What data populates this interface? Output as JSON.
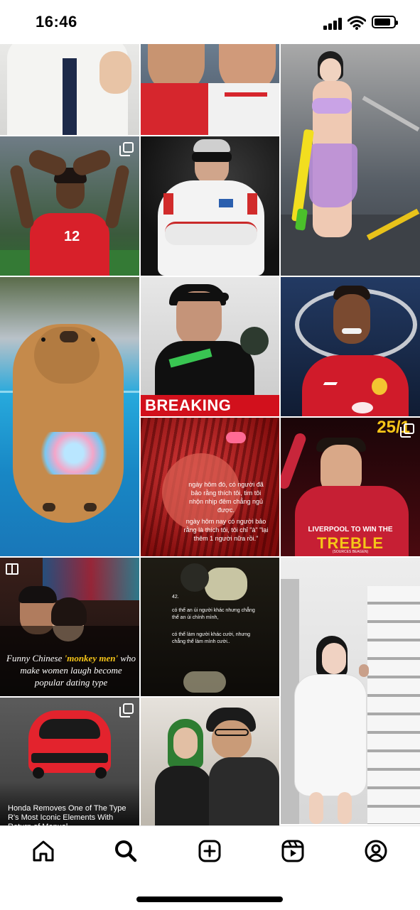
{
  "status_bar": {
    "time": "16:46"
  },
  "grid": {
    "tile6_caption": "BREAKING",
    "tile7_text_1": "ngày hôm đó, có người đã bảo rằng thích tôi, tim tôi nhộn nhịp đêm chẳng ngủ được.",
    "tile7_text_2": "ngày hôm nay có người bảo rằng là thích tôi, tôi chỉ \"à\" \"lại thêm 1 người nữa rồi.\"",
    "tile8_number": "25/1",
    "tile8_title_1": "LIVERPOOL TO WIN THE",
    "tile8_title_2": "TREBLE",
    "tile8_sub": "(SOURCES BEAGEN)",
    "tile9_text_plain_1": "Funny Chinese ",
    "tile9_text_accent": "'monkey men'",
    "tile9_text_plain_2": "who make women laugh become popular dating type",
    "tile10_number": "42.",
    "tile10_text_1": "có thể an ủi người khác nhưng chẳng thể an ủi chính mình,",
    "tile10_text_2": "có thể làm người khác cười, nhưng chẳng thể làm mình cười..",
    "tile12_text": "Honda Removes One of The Type R's Most Iconic Elements With Return of Manual..."
  },
  "colors": {
    "accent_yellow": "#f5c518",
    "breaking_red": "#d2101c",
    "mu_red": "#c8102e"
  },
  "tabs": [
    {
      "name": "home-icon"
    },
    {
      "name": "search-icon"
    },
    {
      "name": "create-icon"
    },
    {
      "name": "reels-icon"
    },
    {
      "name": "profile-icon"
    }
  ]
}
